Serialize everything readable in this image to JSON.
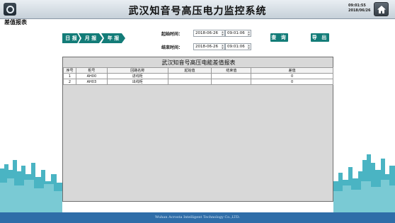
{
  "header": {
    "title": "武汉知音号高压电力监控系统",
    "time": "09:01:55",
    "date": "2018/06/26"
  },
  "page": {
    "title": "差值报表"
  },
  "report_types": [
    {
      "label": "日 报"
    },
    {
      "label": "月 报"
    },
    {
      "label": "年 报"
    }
  ],
  "filters": {
    "start_label": "起始时间：",
    "start_date": "2018-06-26",
    "start_time": "09:01:06",
    "end_label": "结束时间：",
    "end_date": "2018-06-26",
    "end_time": "09:01:06"
  },
  "actions": {
    "query_label": "查 询",
    "export_label": "导 出"
  },
  "report": {
    "title": "武汉知音号高压电能差值报表",
    "columns": [
      "序号",
      "柜号",
      "回路名称",
      "起始值",
      "结束值",
      "差值"
    ],
    "rows": [
      [
        "1",
        "AH00",
        "进线柜",
        "",
        "",
        "0"
      ],
      [
        "2",
        "AH03",
        "出线柜",
        "",
        "",
        "0"
      ]
    ]
  },
  "footer": {
    "text": "Wuhan Acrosta Intelligent Technology Co.,LTD."
  },
  "colors": {
    "accent": "#137c78",
    "footer": "#2f6da8",
    "skyline": "#2aa7b8"
  },
  "icons": {
    "logo": "app-logo-icon",
    "home": "home-icon"
  }
}
